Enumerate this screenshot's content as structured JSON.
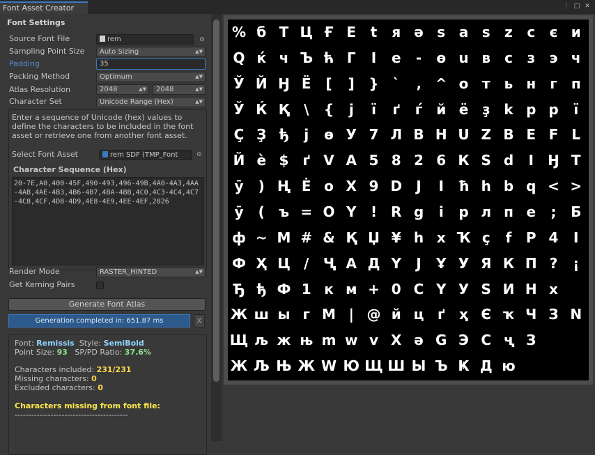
{
  "window": {
    "tab_title": "Font Asset Creator"
  },
  "section_title": "Font Settings",
  "fields": {
    "source_font_file": {
      "label": "Source Font File",
      "value": "rem"
    },
    "sampling_point_size": {
      "label": "Sampling Point Size",
      "value": "Auto Sizing"
    },
    "padding": {
      "label": "Padding",
      "value": "35"
    },
    "packing_method": {
      "label": "Packing Method",
      "value": "Optimum"
    },
    "atlas_resolution": {
      "label": "Atlas Resolution",
      "width": "2048",
      "height": "2048"
    },
    "character_set": {
      "label": "Character Set",
      "value": "Unicode Range (Hex)"
    }
  },
  "help_text": "Enter a sequence of Unicode (hex) values to define the characters to be included in the font asset or retrieve one from another font asset.",
  "select_font_asset": {
    "label": "Select Font Asset",
    "value": "rem SDF (TMP_Font"
  },
  "character_sequence": {
    "label": "Character Sequence (Hex)",
    "value": "20-7E,A0,400-45F,490-493,496-49B,4A0-4A3,4AA-4AB,4AE-4B3,4B6-4B7,4BA-4BB,4C0,4C3-4C4,4C7-4C8,4CF,4D8-4D9,4E8-4E9,4EE-4EF,2026"
  },
  "render_mode": {
    "label": "Render Mode",
    "value": "RASTER_HINTED"
  },
  "kerning": {
    "label": "Get Kerning Pairs",
    "checked": false
  },
  "generate_button": "Generate Font Atlas",
  "progress": {
    "text": "Generation completed in: 651.87 ms",
    "fraction": 1.0,
    "close": "X"
  },
  "info": {
    "font_label": "Font:",
    "font_value": "Remissis",
    "style_label": "Style:",
    "style_value": "SemiBold",
    "point_size_label": "Point Size:",
    "point_size_value": "93",
    "ratio_label": "SP/PD Ratio:",
    "ratio_value": "37.6%",
    "included_label": "Characters included:",
    "included_value": "231/231",
    "missing_label": "Missing characters:",
    "missing_value": "0",
    "excluded_label": "Excluded characters:",
    "excluded_value": "0",
    "missing_header": "Characters missing from font file:",
    "separator": "-----------------------------------------"
  },
  "atlas_rows": [
    [
      "%",
      "б",
      "Т",
      "Ц",
      "Ғ",
      "Е",
      "t",
      "я",
      "ə",
      "s",
      "a",
      "s",
      "z",
      "c",
      "є",
      "и"
    ],
    [
      "Q",
      "ќ",
      "ч",
      "Ъ",
      "ћ",
      "Г",
      "I",
      "е",
      "-",
      "ө",
      "u",
      "в",
      "с",
      "з",
      "э",
      "ч"
    ],
    [
      "Ў",
      "Й",
      "Ӈ",
      "Ё",
      "[",
      "]",
      "}",
      "`",
      "‚",
      "^",
      "о",
      "т",
      "ь",
      "н",
      "г",
      "п"
    ],
    [
      "Ў",
      "Ќ",
      "Қ",
      "\\",
      "{",
      "j",
      "ї",
      "ґ",
      "ѓ",
      "й",
      "ё",
      "ҙ",
      "k",
      "р",
      "р",
      "ї"
    ],
    [
      "Ç",
      "Ҙ",
      "ђ",
      "j",
      "ө",
      "У",
      "7",
      "Л",
      "В",
      "Н",
      "U",
      "Z",
      "В",
      "Е",
      "F",
      "L"
    ],
    [
      "Й",
      "è",
      "$",
      "ґ",
      "V",
      "А",
      "5",
      "8",
      "2",
      "6",
      "К",
      "S",
      "d",
      "І",
      "Ӈ",
      "Т"
    ],
    [
      "ӯ",
      ")",
      "Ң",
      "Ė",
      "о",
      "Х",
      "9",
      "D",
      "J",
      "I",
      "ħ",
      "h",
      "b",
      "q",
      "<",
      ">"
    ],
    [
      "ӯ",
      "(",
      "ъ",
      "=",
      "О",
      "Y",
      "!",
      "R",
      "g",
      "і",
      "р",
      "л",
      "п",
      "е",
      ";",
      "Б"
    ],
    [
      "ф",
      "~",
      "М",
      "#",
      "&",
      "Қ",
      "Џ",
      "¥",
      "h",
      "х",
      "Ҡ",
      "ç",
      "f",
      "Р",
      "4",
      "І"
    ],
    [
      "Ф",
      "Ҳ",
      "Ц",
      "/",
      "Ҷ",
      "А",
      "Д",
      "Y",
      "J",
      "Ұ",
      "У",
      "Я",
      "К",
      "П",
      "?",
      "¡"
    ],
    [
      "Ђ",
      "ђ",
      "Ф",
      "1",
      "к",
      "м",
      "+",
      "0",
      "С",
      "Ү",
      "У",
      "S",
      "И",
      "Н",
      "х"
    ],
    [
      "Ж",
      "ш",
      "ы",
      "г",
      "М",
      "|",
      "@",
      "й",
      "ц",
      "ґ",
      "ҳ",
      "Є",
      "ҡ",
      "Ч",
      "З",
      "N"
    ],
    [
      "Щ",
      "љ",
      "ж",
      "њ",
      "m",
      "w",
      "v",
      "X",
      "ә",
      "G",
      "Э",
      "С",
      "ҷ",
      "З"
    ],
    [
      "Ж",
      "Љ",
      "Њ",
      "Ж",
      "W",
      "Ю",
      "Щ",
      "Ш",
      "Ы",
      "Ъ",
      "Ҝ",
      "Д",
      "ю"
    ]
  ]
}
